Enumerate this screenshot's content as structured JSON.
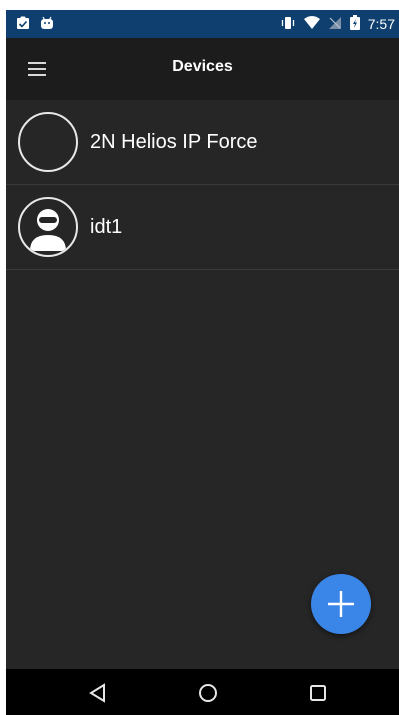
{
  "status_bar": {
    "time": "7:57",
    "icons": [
      "clipboard-check-icon",
      "android-icon",
      "vibrate-icon",
      "wifi-icon",
      "no-signal-icon",
      "battery-charging-icon"
    ]
  },
  "app_bar": {
    "title": "Devices",
    "menu_icon": "hamburger-menu-icon"
  },
  "devices": [
    {
      "label": "2N Helios IP Force",
      "avatar": "empty-circle"
    },
    {
      "label": "idt1",
      "avatar": "user-avatar-icon"
    }
  ],
  "fab": {
    "icon": "plus-icon"
  },
  "nav_bar": {
    "buttons": [
      "back-triangle-icon",
      "home-circle-icon",
      "recents-square-icon"
    ]
  },
  "colors": {
    "status_bar": "#0e3f6e",
    "app_bar": "#1c1c1c",
    "background": "#262626",
    "fab": "#3a86e8",
    "nav_bar": "#000000"
  }
}
